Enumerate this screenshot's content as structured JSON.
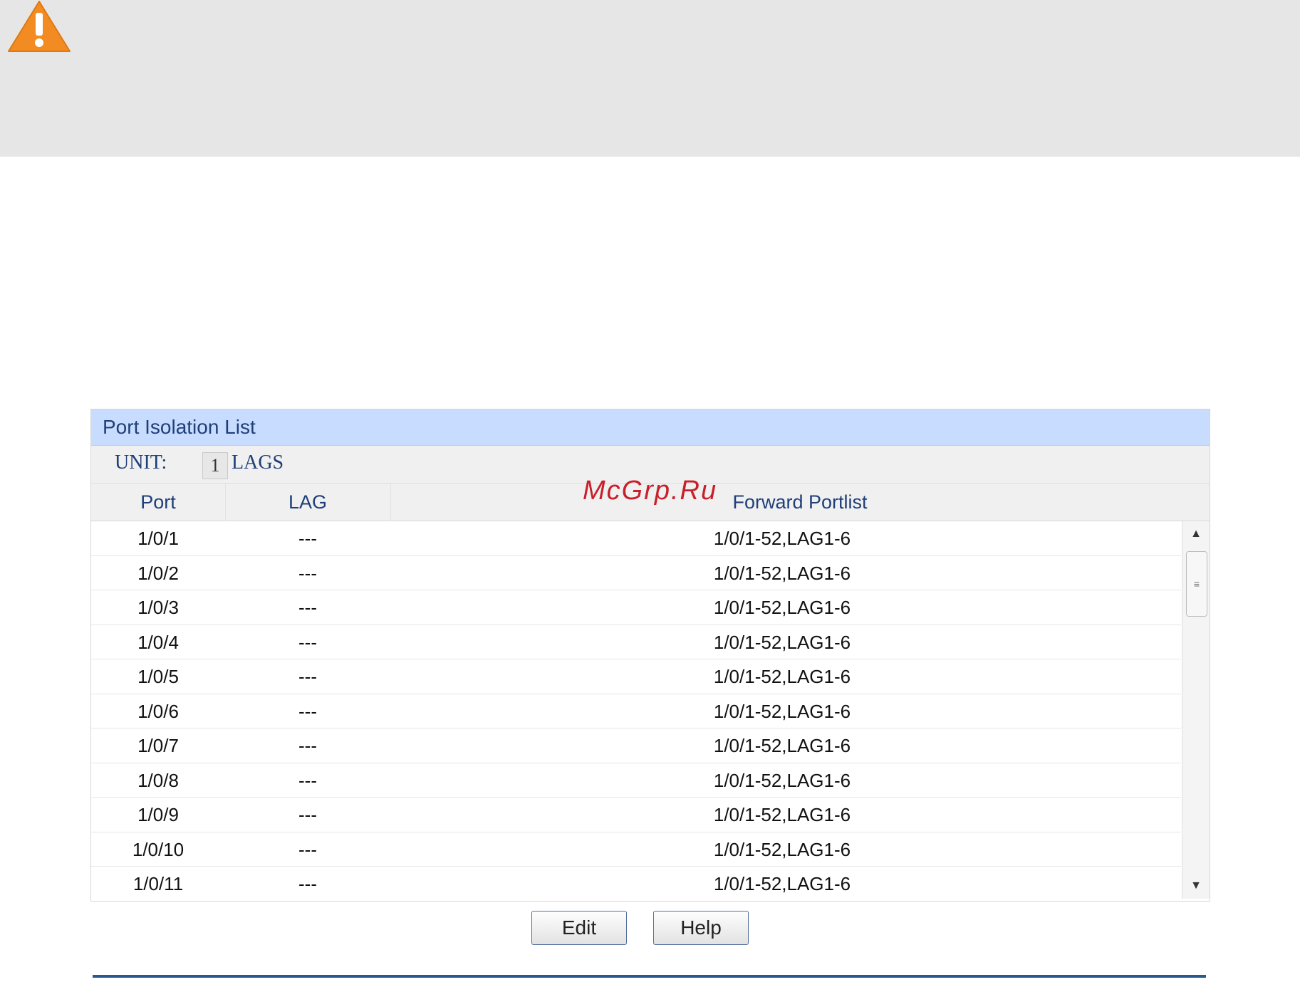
{
  "colors": {
    "warning": "#f28c22",
    "panel_header_bg": "#c7dcff",
    "panel_header_text": "#1f3f78",
    "button_border": "#4f6f9f",
    "bottom_rule": "#29588f",
    "watermark": "#c8202a"
  },
  "icons": {
    "warning": "warning-triangle-icon"
  },
  "panel": {
    "title": "Port Isolation List",
    "unit_label": "UNIT:",
    "unit_value": "1",
    "lags_label": "LAGS"
  },
  "table": {
    "headers": {
      "port": "Port",
      "lag": "LAG",
      "forward": "Forward Portlist"
    },
    "rows": [
      {
        "port": "1/0/1",
        "lag": "---",
        "forward": "1/0/1-52,LAG1-6"
      },
      {
        "port": "1/0/2",
        "lag": "---",
        "forward": "1/0/1-52,LAG1-6"
      },
      {
        "port": "1/0/3",
        "lag": "---",
        "forward": "1/0/1-52,LAG1-6"
      },
      {
        "port": "1/0/4",
        "lag": "---",
        "forward": "1/0/1-52,LAG1-6"
      },
      {
        "port": "1/0/5",
        "lag": "---",
        "forward": "1/0/1-52,LAG1-6"
      },
      {
        "port": "1/0/6",
        "lag": "---",
        "forward": "1/0/1-52,LAG1-6"
      },
      {
        "port": "1/0/7",
        "lag": "---",
        "forward": "1/0/1-52,LAG1-6"
      },
      {
        "port": "1/0/8",
        "lag": "---",
        "forward": "1/0/1-52,LAG1-6"
      },
      {
        "port": "1/0/9",
        "lag": "---",
        "forward": "1/0/1-52,LAG1-6"
      },
      {
        "port": "1/0/10",
        "lag": "---",
        "forward": "1/0/1-52,LAG1-6"
      },
      {
        "port": "1/0/11",
        "lag": "---",
        "forward": "1/0/1-52,LAG1-6"
      }
    ]
  },
  "buttons": {
    "edit": "Edit",
    "help": "Help"
  },
  "watermark": "McGrp.Ru"
}
